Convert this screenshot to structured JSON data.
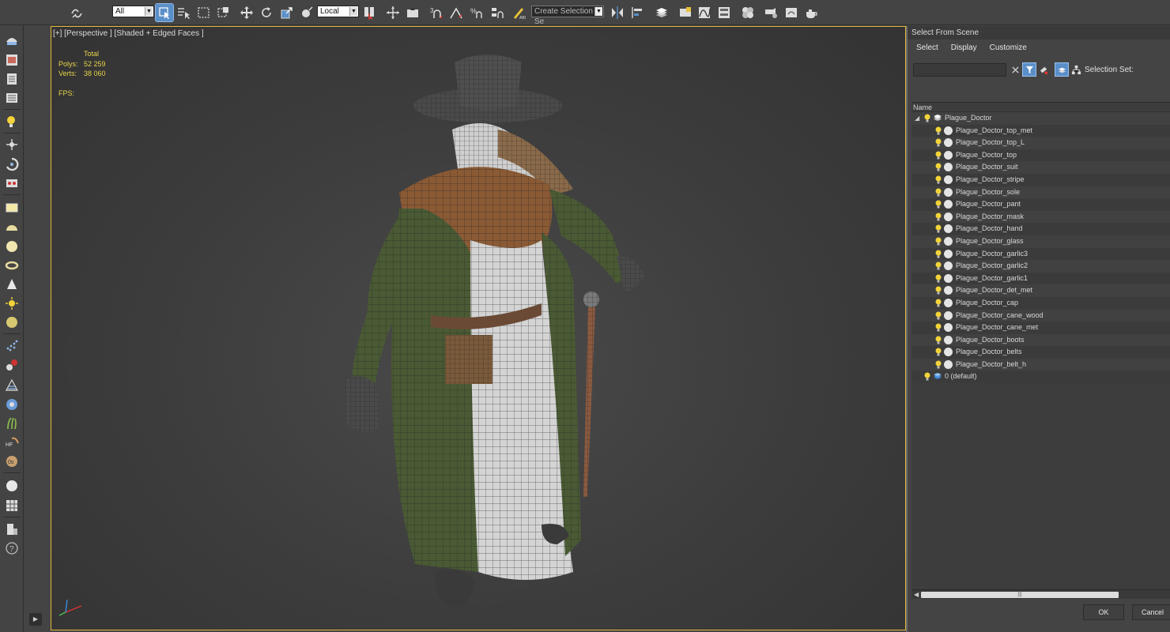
{
  "toolbar": {
    "filter_value": "All",
    "coord_value": "Local",
    "selection_set_value": "Create Selection Se"
  },
  "viewport": {
    "label": "[+] [Perspective ] [Shaded + Edged Faces ]",
    "stats_header": "Total",
    "polys_label": "Polys:",
    "polys_value": "52 259",
    "verts_label": "Verts:",
    "verts_value": "38 060",
    "fps_label": "FPS:"
  },
  "dialog": {
    "title": "Select From Scene",
    "menu": [
      "Select",
      "Display",
      "Customize"
    ],
    "search_value": "",
    "selection_set_label": "Selection Set:",
    "column_name": "Name",
    "root": "Plague_Doctor",
    "items": [
      "Plague_Doctor_top_met",
      "Plague_Doctor_top_L",
      "Plague_Doctor_top",
      "Plague_Doctor_suit",
      "Plague_Doctor_stripe",
      "Plague_Doctor_sole",
      "Plague_Doctor_pant",
      "Plague_Doctor_mask",
      "Plague_Doctor_hand",
      "Plague_Doctor_glass",
      "Plague_Doctor_garlic3",
      "Plague_Doctor_garlic2",
      "Plague_Doctor_garlic1",
      "Plague_Doctor_det_met",
      "Plague_Doctor_cap",
      "Plague_Doctor_cane_wood",
      "Plague_Doctor_cane_met",
      "Plague_Doctor_boots",
      "Plague_Doctor_belts",
      "Plague_Doctor_belt_h"
    ],
    "default_layer": "0 (default)",
    "ok_label": "OK",
    "cancel_label": "Cancel"
  },
  "colors": {
    "accent": "#5b8fc9",
    "viewport_border": "#e0b83a",
    "stats_text": "#e6d24a",
    "bulb": "#f2d33a"
  }
}
